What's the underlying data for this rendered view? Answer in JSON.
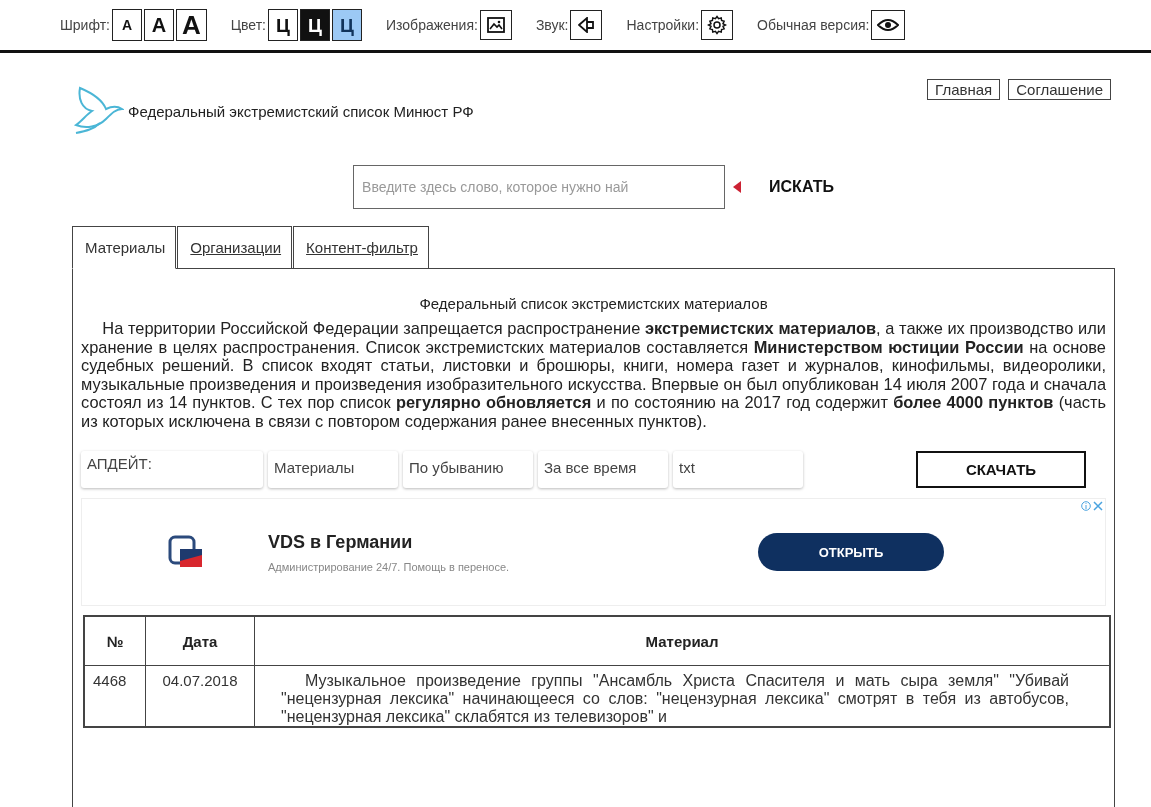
{
  "toolbar": {
    "font": {
      "label": "Шрифт:",
      "sizes": [
        {
          "label": "A",
          "kind": "small"
        },
        {
          "label": "A",
          "kind": "medium"
        },
        {
          "label": "A",
          "kind": "large"
        }
      ]
    },
    "color": {
      "label": "Цвет:",
      "options": [
        {
          "label": "Ц",
          "kind": "light"
        },
        {
          "label": "Ц",
          "kind": "dark"
        },
        {
          "label": "Ц",
          "kind": "blue"
        }
      ]
    },
    "tools": [
      {
        "label": "Изображения:",
        "kind": "image"
      },
      {
        "label": "Звук:",
        "kind": "sound"
      },
      {
        "label": "Настройки:",
        "kind": "settings"
      },
      {
        "label": "Обычная версия:",
        "kind": "eye"
      }
    ]
  },
  "header": {
    "title": "Федеральный экстремистский список Минюст РФ",
    "nav": [
      "Главная",
      "Соглашение"
    ]
  },
  "search": {
    "placeholder": "Введите здесь слово, которое нужно най",
    "button": "ИСКАТЬ"
  },
  "tabs": [
    {
      "label": "Материалы",
      "selected": true
    },
    {
      "label": "Организации",
      "selected": false
    },
    {
      "label": "Контент-фильтр",
      "selected": false
    }
  ],
  "panel": {
    "title": "Федеральный список экстремистских материалов",
    "intro": "На территории Российской Федерации запрещается распространение **экстремистских материалов**, а также их производство или хранение в целях распространения. Список экстремистских материалов составляется **Министерством юстиции России** на основе судебных решений. В список входят статьи, листовки и брошюры, книги, номера газет и журналов, кинофильмы, видеоролики, музыкальные произведения и произведения изобразительного искусства. Впервые он был опубликован 14 июля 2007 года и сначала состоял из 14 пунктов. С тех пор список **регулярно обновляется** и по состоянию на 2017 год содержит **более 4000 пунктов** (часть из которых исключена в связи с повтором содержания ранее внесенных пунктов).",
    "filters": [
      "АПДЕЙТ:",
      "Материалы",
      "По убыванию",
      "За все время",
      "txt"
    ],
    "download": "СКАЧАТЬ"
  },
  "ad": {
    "title": "VDS в Германии",
    "subtitle": "Администрирование 24/7. Помощь в переносе.",
    "button": "ОТКРЫТЬ"
  },
  "table": {
    "columns": [
      "№",
      "Дата",
      "Материал"
    ],
    "rows": [
      {
        "number": "4468",
        "date": "04.07.2018",
        "material": "Музыкальное произведение группы \"Ансамбль Христа Спасителя и мать сыра земля\" \"Убивай \"нецензурная лексика\" начинающееся со слов: \"нецензурная лексика\" смотрят в тебя из автобусов, \"нецензурная лексика\" склабятся из телевизоров\" и"
      }
    ]
  }
}
